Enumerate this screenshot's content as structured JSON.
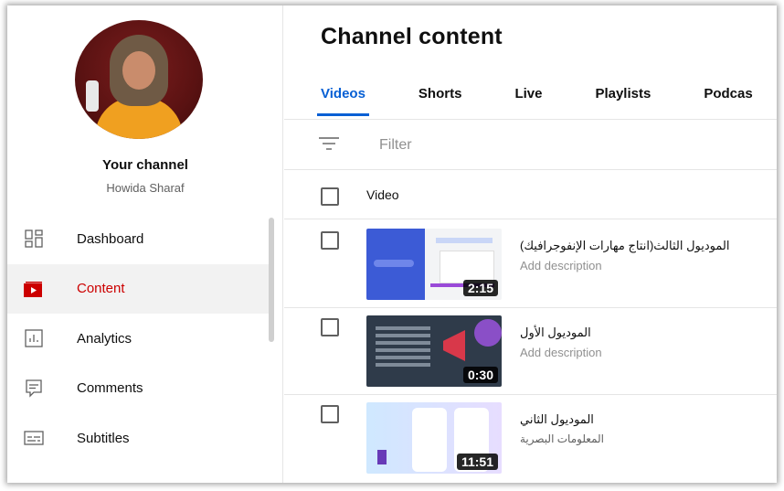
{
  "sidebar": {
    "channel_title": "Your channel",
    "channel_name": "Howida Sharaf",
    "items": [
      {
        "label": "Dashboard",
        "icon": "dashboard-icon",
        "active": false
      },
      {
        "label": "Content",
        "icon": "content-icon",
        "active": true
      },
      {
        "label": "Analytics",
        "icon": "analytics-icon",
        "active": false
      },
      {
        "label": "Comments",
        "icon": "comments-icon",
        "active": false
      },
      {
        "label": "Subtitles",
        "icon": "subtitles-icon",
        "active": false
      }
    ]
  },
  "main": {
    "title": "Channel content",
    "tabs": [
      {
        "label": "Videos",
        "active": true
      },
      {
        "label": "Shorts",
        "active": false
      },
      {
        "label": "Live",
        "active": false
      },
      {
        "label": "Playlists",
        "active": false
      },
      {
        "label": "Podcas",
        "active": false
      }
    ],
    "filter_placeholder": "Filter",
    "column_header": "Video",
    "videos": [
      {
        "title": "الموديول الثالث(انتاج مهارات الإنفوجرافيك)",
        "description": "Add description",
        "duration": "2:15"
      },
      {
        "title": "الموديول الأول",
        "description": "Add description",
        "duration": "0:30"
      },
      {
        "title": "الموديول الثاني",
        "description": "المعلومات البصرية",
        "duration": "11:51"
      }
    ]
  },
  "colors": {
    "accent_blue": "#065fd4",
    "active_red": "#cc0000",
    "text_secondary": "#606060"
  }
}
